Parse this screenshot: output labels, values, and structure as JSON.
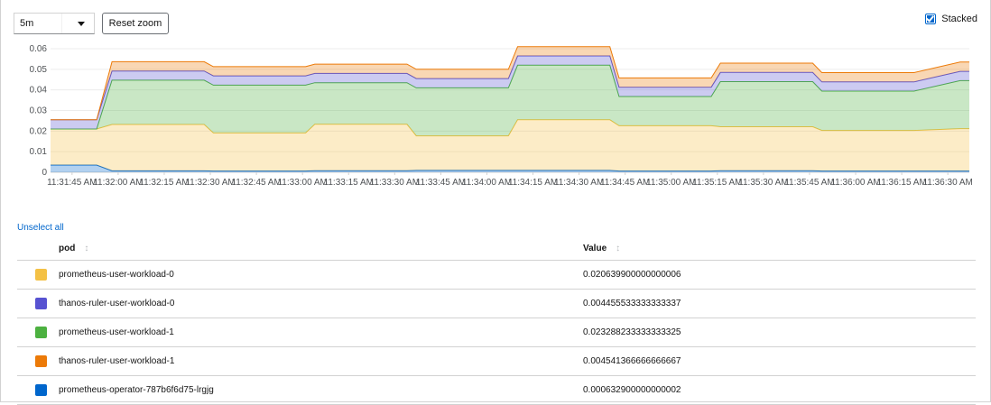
{
  "controls": {
    "timespan_value": "5m",
    "reset_zoom_label": "Reset zoom",
    "stacked_label": "Stacked",
    "stacked_checked": true
  },
  "chart_data": {
    "type": "area",
    "stacked": true,
    "ylim": [
      0,
      0.06
    ],
    "yticks": [
      "0",
      "0.01",
      "0.02",
      "0.03",
      "0.04",
      "0.05",
      "0.06"
    ],
    "xticks": [
      "11:31:45 AM",
      "11:32:00 AM",
      "11:32:15 AM",
      "11:32:30 AM",
      "11:32:45 AM",
      "11:33:00 AM",
      "11:33:15 AM",
      "11:33:30 AM",
      "11:33:45 AM",
      "11:34:00 AM",
      "11:34:15 AM",
      "11:34:30 AM",
      "11:34:45 AM",
      "11:35:00 AM",
      "11:35:15 AM",
      "11:35:30 AM",
      "11:35:45 AM",
      "11:36:00 AM",
      "11:36:15 AM",
      "11:36:30 AM"
    ],
    "x": [
      "11:31:38",
      "11:31:53",
      "11:31:58",
      "11:32:13",
      "11:32:28",
      "11:32:31",
      "11:32:46",
      "11:33:01",
      "11:33:04",
      "11:33:19",
      "11:33:34",
      "11:33:37",
      "11:33:52",
      "11:34:07",
      "11:34:10",
      "11:34:25",
      "11:34:40",
      "11:34:43",
      "11:34:58",
      "11:35:13",
      "11:35:16",
      "11:35:31",
      "11:35:46",
      "11:35:49",
      "11:36:04",
      "11:36:19",
      "11:36:34",
      "11:36:37"
    ],
    "series": [
      {
        "name": "prometheus-operator-787b6f6d75-lrgjg",
        "color": "#0066cc",
        "values": [
          0.0035,
          0.0035,
          0.0007,
          0.0007,
          0.0007,
          0.0006,
          0.0006,
          0.0006,
          0.0008,
          0.0008,
          0.0008,
          0.0009,
          0.0009,
          0.0009,
          0.0009,
          0.0009,
          0.0009,
          0.0006,
          0.0006,
          0.0006,
          0.0008,
          0.0008,
          0.0008,
          0.0006,
          0.0006,
          0.0006,
          0.0006,
          0.0006
        ]
      },
      {
        "name": "prometheus-user-workload-0",
        "color": "#f4c145",
        "values": [
          0.0175,
          0.0175,
          0.0225,
          0.0225,
          0.0225,
          0.0185,
          0.0185,
          0.0185,
          0.0225,
          0.0225,
          0.0225,
          0.0168,
          0.0168,
          0.0168,
          0.0246,
          0.0246,
          0.0246,
          0.022,
          0.022,
          0.022,
          0.0213,
          0.0213,
          0.0213,
          0.0197,
          0.0197,
          0.0197,
          0.0206,
          0.0206
        ]
      },
      {
        "name": "prometheus-user-workload-1",
        "color": "#4cb140",
        "values": [
          0,
          0,
          0.0215,
          0.0215,
          0.0215,
          0.0232,
          0.0232,
          0.0232,
          0.0202,
          0.0202,
          0.0202,
          0.0233,
          0.0233,
          0.0233,
          0.0265,
          0.0265,
          0.0265,
          0.0142,
          0.0142,
          0.0142,
          0.0219,
          0.0219,
          0.0219,
          0.0191,
          0.0191,
          0.0191,
          0.0233,
          0.0233
        ]
      },
      {
        "name": "thanos-ruler-user-workload-0",
        "color": "#5752d1",
        "values": [
          0.0045,
          0.0045,
          0.0045,
          0.0045,
          0.0045,
          0.0045,
          0.0045,
          0.0045,
          0.0045,
          0.0045,
          0.0045,
          0.0045,
          0.0045,
          0.0045,
          0.0045,
          0.0045,
          0.0045,
          0.0045,
          0.0045,
          0.0045,
          0.0045,
          0.0045,
          0.0045,
          0.0045,
          0.0045,
          0.0045,
          0.0045,
          0.0045
        ]
      },
      {
        "name": "thanos-ruler-user-workload-1",
        "color": "#ec7a08",
        "values": [
          0,
          0,
          0.0045,
          0.0045,
          0.0045,
          0.0045,
          0.0045,
          0.0045,
          0.0045,
          0.0045,
          0.0045,
          0.0045,
          0.0045,
          0.0045,
          0.0045,
          0.0045,
          0.0045,
          0.0045,
          0.0045,
          0.0045,
          0.0045,
          0.0045,
          0.0045,
          0.0045,
          0.0045,
          0.0045,
          0.0045,
          0.0045
        ]
      }
    ]
  },
  "table": {
    "unselect_all_label": "Unselect all",
    "headers": {
      "pod": "pod",
      "value": "Value"
    },
    "rows": [
      {
        "pod": "prometheus-user-workload-0",
        "value": "0.020639900000000006",
        "color": "#f4c145"
      },
      {
        "pod": "thanos-ruler-user-workload-0",
        "value": "0.004455533333333337",
        "color": "#5752d1"
      },
      {
        "pod": "prometheus-user-workload-1",
        "value": "0.023288233333333325",
        "color": "#4cb140"
      },
      {
        "pod": "thanos-ruler-user-workload-1",
        "value": "0.004541366666666667",
        "color": "#ec7a08"
      },
      {
        "pod": "prometheus-operator-787b6f6d75-lrgjg",
        "value": "0.000632900000000002",
        "color": "#0066cc"
      }
    ]
  }
}
